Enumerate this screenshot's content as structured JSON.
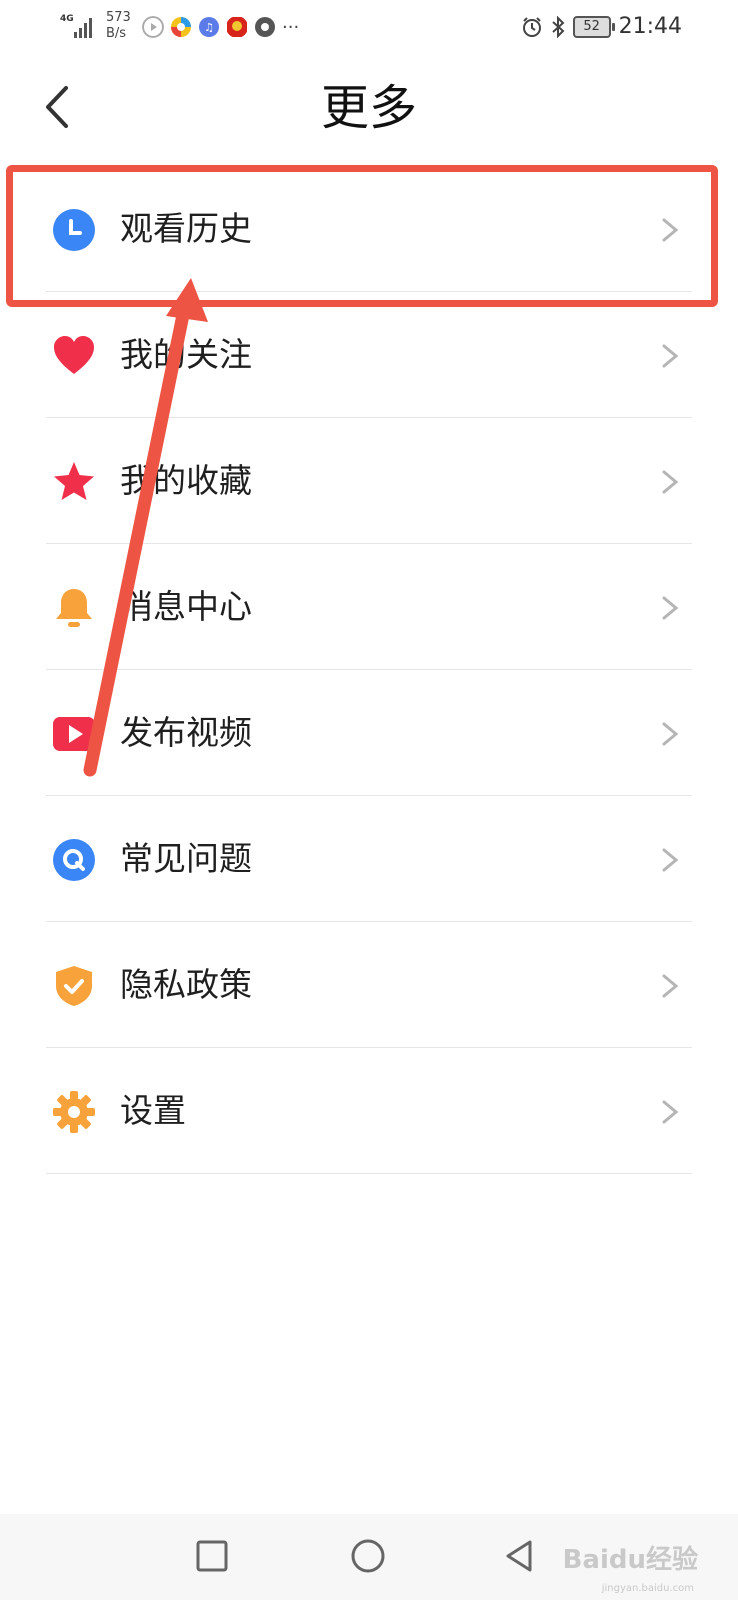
{
  "status_bar": {
    "network": "4G",
    "speed_value": "573",
    "speed_unit": "B/s",
    "battery": "52",
    "time": "21:44",
    "more": "···"
  },
  "header": {
    "title": "更多",
    "back_icon": "chevron-left-icon"
  },
  "menu": {
    "items": [
      {
        "label": "观看历史",
        "icon": "clock-icon",
        "color": "#3a86f7"
      },
      {
        "label": "我的关注",
        "icon": "heart-icon",
        "color": "#f0304a"
      },
      {
        "label": "我的收藏",
        "icon": "star-icon",
        "color": "#f0304a"
      },
      {
        "label": "消息中心",
        "icon": "bell-icon",
        "color": "#f7a23a"
      },
      {
        "label": "发布视频",
        "icon": "video-play-icon",
        "color": "#f0304a"
      },
      {
        "label": "常见问题",
        "icon": "question-icon",
        "color": "#3a86f7"
      },
      {
        "label": "隐私政策",
        "icon": "shield-check-icon",
        "color": "#f7a23a"
      },
      {
        "label": "设置",
        "icon": "gear-icon",
        "color": "#f7a23a"
      }
    ]
  },
  "annotation": {
    "color": "#ee5443"
  },
  "watermark": {
    "text": "Baidu经验",
    "sub": "jingyan.baidu.com"
  }
}
